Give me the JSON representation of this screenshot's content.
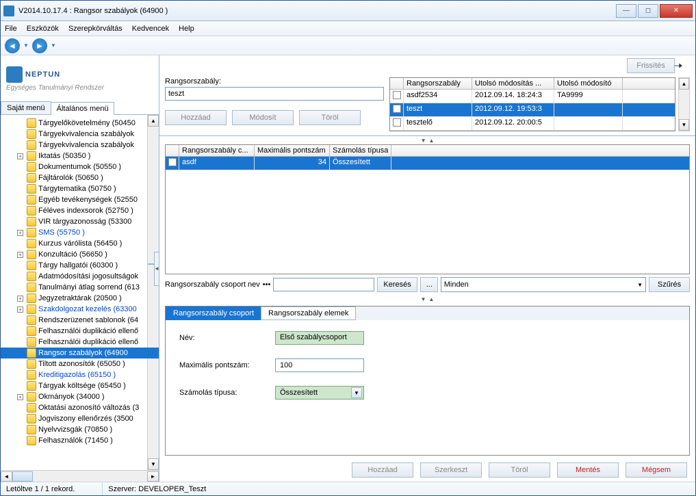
{
  "window": {
    "title": "V2014.10.17.4 : Rangsor szabályok (64900  )"
  },
  "menubar": [
    "File",
    "Eszközök",
    "Szerepkörváltás",
    "Kedvencek",
    "Help"
  ],
  "logo": {
    "text": "NEPTUN",
    "sub": "Egységes Tanulmányi Rendszer"
  },
  "side_tabs": {
    "inactive": "Saját menü",
    "active": "Általános menü"
  },
  "tree": [
    {
      "label": "Tárgyelőkövetelmény (50450",
      "l": 2,
      "exp": ""
    },
    {
      "label": "Tárgyekvivalencia szabályok",
      "l": 2,
      "exp": ""
    },
    {
      "label": "Tárgyekvivalencia szabályok",
      "l": 2,
      "exp": ""
    },
    {
      "label": "Iktatás (50350  )",
      "l": 2,
      "exp": "+"
    },
    {
      "label": "Dokumentumok (50550  )",
      "l": 2,
      "exp": ""
    },
    {
      "label": "Fájltárolók (50650  )",
      "l": 2,
      "exp": ""
    },
    {
      "label": "Tárgytematika (50750  )",
      "l": 2,
      "exp": ""
    },
    {
      "label": "Egyéb tevékenységek (52550",
      "l": 2,
      "exp": ""
    },
    {
      "label": "Féléves indexsorok (52750  )",
      "l": 2,
      "exp": ""
    },
    {
      "label": "VIR tárgyazonosság (53300",
      "l": 2,
      "exp": ""
    },
    {
      "label": "SMS (55750  )",
      "l": 2,
      "exp": "+",
      "blue": true
    },
    {
      "label": "Kurzus várólista (56450  )",
      "l": 2,
      "exp": ""
    },
    {
      "label": "Konzultáció (56650  )",
      "l": 2,
      "exp": "+"
    },
    {
      "label": "Tárgy hallgatói (60300  )",
      "l": 2,
      "exp": ""
    },
    {
      "label": "Adatmódosítási jogosultságok",
      "l": 2,
      "exp": ""
    },
    {
      "label": "Tanulmányi átlag sorrend (613",
      "l": 2,
      "exp": ""
    },
    {
      "label": "Jegyzetraktárak (20500  )",
      "l": 2,
      "exp": "+"
    },
    {
      "label": "Szakdolgozat kezelés (63300",
      "l": 2,
      "exp": "+",
      "blue": true
    },
    {
      "label": "Rendszerüzenet sablonok (64",
      "l": 2,
      "exp": ""
    },
    {
      "label": "Felhasználói duplikáció ellenő",
      "l": 2,
      "exp": ""
    },
    {
      "label": "Felhasználói duplikáció ellenő",
      "l": 2,
      "exp": ""
    },
    {
      "label": "Rangsor szabályok (64900",
      "l": 2,
      "exp": "",
      "sel": true
    },
    {
      "label": "Tiltott azonosítók (65050  )",
      "l": 2,
      "exp": ""
    },
    {
      "label": "Kreditigazolás (65150  )",
      "l": 2,
      "exp": "",
      "blue": true
    },
    {
      "label": "Tárgyak költsége (65450  )",
      "l": 2,
      "exp": ""
    },
    {
      "label": "Okmányok (34000  )",
      "l": 2,
      "exp": "+"
    },
    {
      "label": "Oktatási azonosító változás (3",
      "l": 2,
      "exp": ""
    },
    {
      "label": "Jogviszony ellenőrzés (3500",
      "l": 2,
      "exp": ""
    },
    {
      "label": "Nyelvvizsgák (70850  )",
      "l": 2,
      "exp": ""
    },
    {
      "label": "Felhasználók (71450  )",
      "l": 2,
      "exp": ""
    }
  ],
  "refresh_btn": "Frissítés",
  "form": {
    "rule_label": "Rangsorszabály:",
    "rule_value": "teszt"
  },
  "form_btns": {
    "add": "Hozzáad",
    "edit": "Módosít",
    "del": "Töröl"
  },
  "top_grid": {
    "headers": [
      "",
      "Rangsorszabály",
      "Utolsó módosítás ...",
      "Utolsó módosító"
    ],
    "rows": [
      {
        "c": [
          "",
          "asdf2534",
          "2012.09.14. 18:24:3",
          "TA9999"
        ],
        "sel": false
      },
      {
        "c": [
          "",
          "teszt",
          "2012.09.12. 19:53:3",
          ""
        ],
        "sel": true
      },
      {
        "c": [
          "",
          "tesztelő",
          "2012.09.12. 20:00:5",
          ""
        ],
        "sel": false
      }
    ]
  },
  "mid_grid": {
    "headers": [
      "",
      "Rangsorszabály c...",
      "Maximális pontszám",
      "Számolás típusa"
    ],
    "rows": [
      {
        "c": [
          "",
          "asdf",
          "34",
          "Összesített"
        ],
        "sel": true
      }
    ]
  },
  "search": {
    "label": "Rangsorszabály csoport nev",
    "btn": "Keresés",
    "dots": "...",
    "combo": "Minden",
    "filter": "Szűrés"
  },
  "detail_tabs": {
    "active": "Rangsorszabály csoport",
    "other": "Rangsorszabály elemek"
  },
  "detail": {
    "name_label": "Név:",
    "name_value": "Első szabálycsoport",
    "max_label": "Maximális pontszám:",
    "max_value": "100",
    "calc_label": "Számolás típusa:",
    "calc_value": "Összesített"
  },
  "bottom_btns": {
    "add": "Hozzáad",
    "edit": "Szerkeszt",
    "del": "Töröl",
    "save": "Mentés",
    "cancel": "Mégsem"
  },
  "status": {
    "left": "Letöltve 1 / 1 rekord.",
    "server": "Szerver: DEVELOPER_Teszt"
  }
}
